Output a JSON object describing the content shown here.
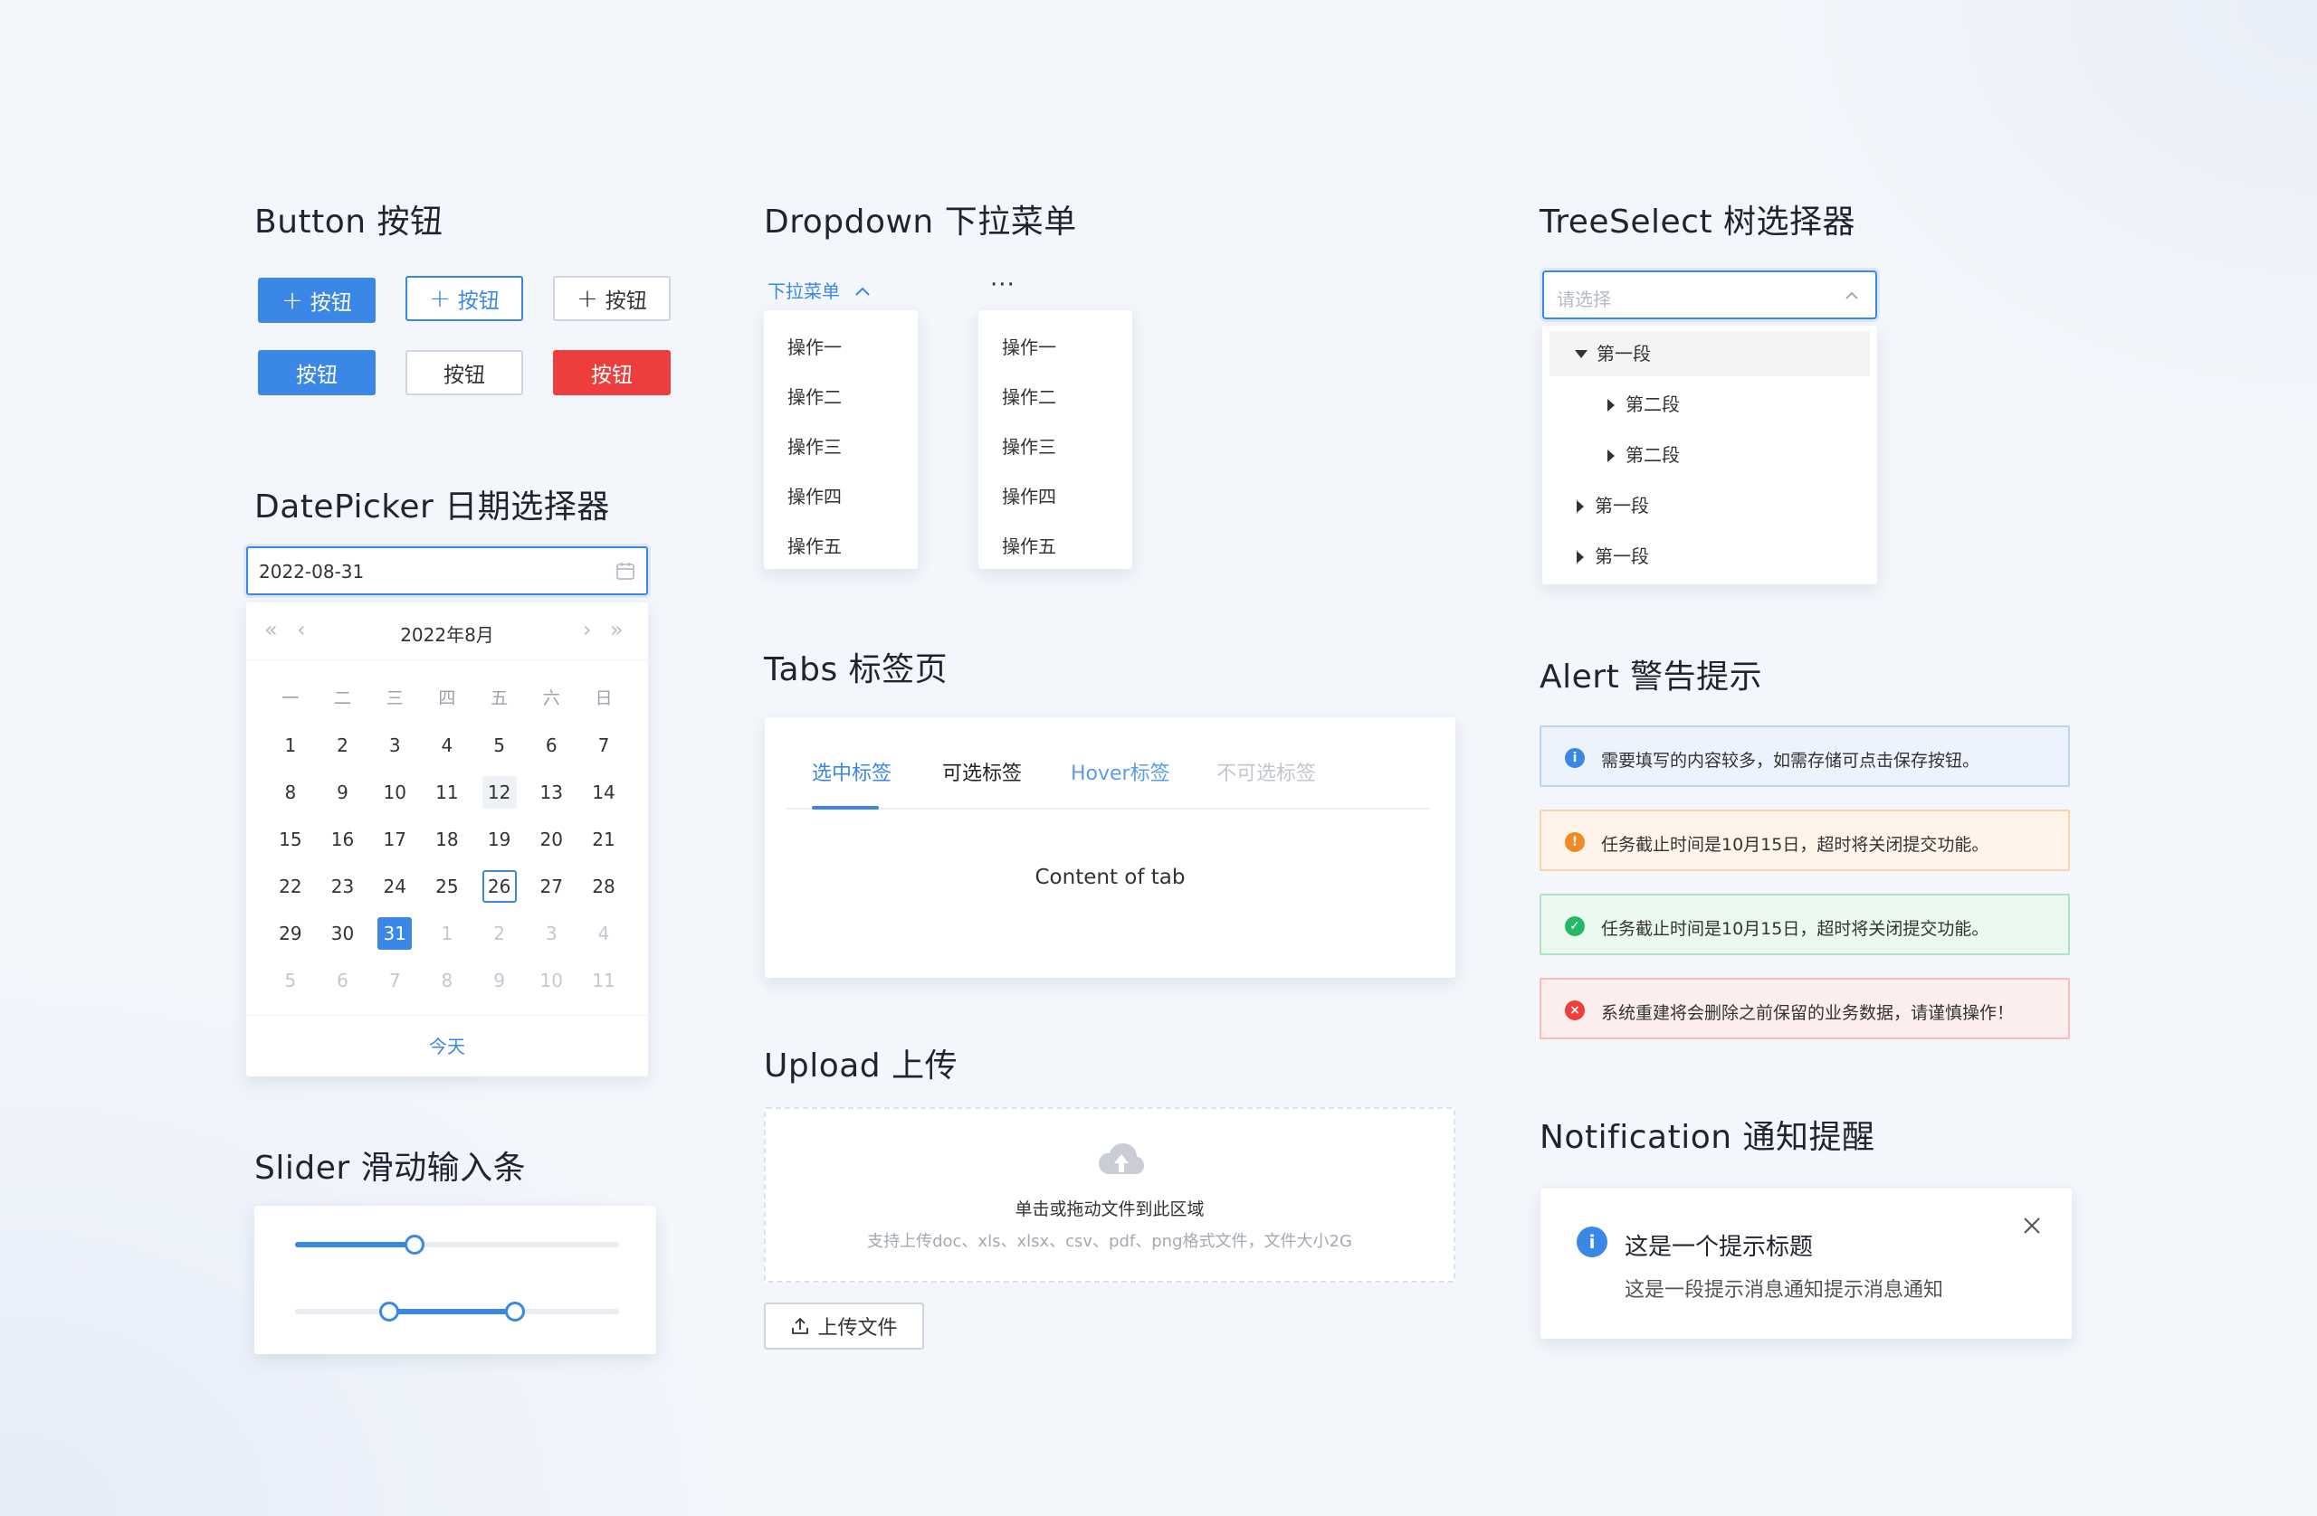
{
  "button": {
    "title": "Button 按钮",
    "row1": [
      {
        "label": "按钮",
        "icon": "plus-icon",
        "variant": "primary"
      },
      {
        "label": "按钮",
        "icon": "plus-icon",
        "variant": "outline-blue"
      },
      {
        "label": "按钮",
        "icon": "plus-icon",
        "variant": "outline"
      }
    ],
    "row2": [
      {
        "label": "按钮",
        "variant": "primary"
      },
      {
        "label": "按钮",
        "variant": "outline"
      },
      {
        "label": "按钮",
        "variant": "danger"
      }
    ]
  },
  "datepicker": {
    "title": "DatePicker 日期选择器",
    "value": "2022-08-31",
    "month_label": "2022年8月",
    "weekdays": [
      "一",
      "二",
      "三",
      "四",
      "五",
      "六",
      "日"
    ],
    "weeks": [
      [
        "1",
        "2",
        "3",
        "4",
        "5",
        "6",
        "7"
      ],
      [
        "8",
        "9",
        "10",
        "11",
        "12",
        "13",
        "14"
      ],
      [
        "15",
        "16",
        "17",
        "18",
        "19",
        "20",
        "21"
      ],
      [
        "22",
        "23",
        "24",
        "25",
        "26",
        "27",
        "28"
      ],
      [
        "29",
        "30",
        "31",
        "1",
        "2",
        "3",
        "4"
      ],
      [
        "5",
        "6",
        "7",
        "8",
        "9",
        "10",
        "11"
      ]
    ],
    "hovered": "12",
    "today": "26",
    "selected": "31",
    "today_button": "今天"
  },
  "slider": {
    "title": "Slider 滑动输入条",
    "single_value": 0.37,
    "range_value": [
      0.29,
      0.68
    ]
  },
  "dropdown": {
    "title": "Dropdown 下拉菜单",
    "trigger_label": "下拉菜单",
    "more_label": "···",
    "menu1": [
      "操作一",
      "操作二",
      "操作三",
      "操作四",
      "操作五"
    ],
    "menu2": [
      "操作一",
      "操作二",
      "操作三",
      "操作四",
      "操作五"
    ]
  },
  "tabs": {
    "title": "Tabs 标签页",
    "items": [
      {
        "label": "选中标签",
        "state": "active"
      },
      {
        "label": "可选标签",
        "state": "normal"
      },
      {
        "label": "Hover标签",
        "state": "hover"
      },
      {
        "label": "不可选标签",
        "state": "disabled"
      }
    ],
    "content": "Content of tab"
  },
  "upload": {
    "title": "Upload 上传",
    "drag_text": "单击或拖动文件到此区域",
    "hint": "支持上传doc、xls、xlsx、csv、pdf、png格式文件，文件大小2G",
    "button_label": "上传文件"
  },
  "treeselect": {
    "title": "TreeSelect 树选择器",
    "placeholder": "请选择",
    "nodes": [
      {
        "label": "第一段",
        "expanded": true
      },
      {
        "label": "第二段",
        "expanded": false
      },
      {
        "label": "第二段",
        "expanded": false
      },
      {
        "label": "第一段",
        "expanded": false
      },
      {
        "label": "第一段",
        "expanded": false
      }
    ]
  },
  "alert": {
    "title": "Alert 警告提示",
    "items": [
      {
        "type": "info",
        "text": "需要填写的内容较多，如需存储可点击保存按钮。",
        "color": "#3a87e6",
        "bg": "#ecf3fd",
        "border": "#bcd5f5"
      },
      {
        "type": "warning",
        "text": "任务截止时间是10月15日，超时将关闭提交功能。",
        "color": "#f08a24",
        "bg": "#fef4ea",
        "border": "#f8d3ac"
      },
      {
        "type": "success",
        "text": "任务截止时间是10月15日，超时将关闭提交功能。",
        "color": "#26b864",
        "bg": "#eaf8f0",
        "border": "#aee3c5"
      },
      {
        "type": "error",
        "text": "系统重建将会删除之前保留的业务数据，请谨慎操作！",
        "color": "#ee3d3d",
        "bg": "#fdeeee",
        "border": "#f5bcbc"
      }
    ]
  },
  "notification": {
    "title": "Notification 通知提醒",
    "heading": "这是一个提示标题",
    "body": "这是一段提示消息通知提示消息通知"
  },
  "colors": {
    "primary": "#3a87e6",
    "danger": "#ee3d3d"
  }
}
